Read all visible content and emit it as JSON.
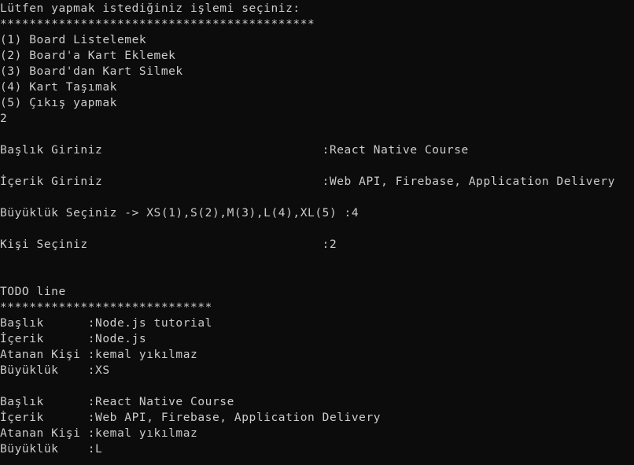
{
  "terminal": {
    "colors": {
      "background": "#0c0c0c",
      "foreground": "#cccccc"
    },
    "lines": [
      "Lütfen yapmak istediğiniz işlemi seçiniz:",
      "*******************************************",
      "(1) Board Listelemek",
      "(2) Board'a Kart Eklemek",
      "(3) Board'dan Kart Silmek",
      "(4) Kart Taşımak",
      "(5) Çıkış yapmak",
      "2",
      "",
      "Başlık Giriniz                              :React Native Course",
      "",
      "İçerik Giriniz                              :Web API, Firebase, Application Delivery",
      "",
      "Büyüklük Seçiniz -> XS(1),S(2),M(3),L(4),XL(5) :4",
      "",
      "Kişi Seçiniz                                :2",
      "",
      "",
      "TODO line",
      "*****************************",
      "Başlık      :Node.js tutorial",
      "İçerik      :Node.js",
      "Atanan Kişi :kemal yıkılmaz",
      "Büyüklük    :XS",
      "",
      "Başlık      :React Native Course",
      "İçerik      :Web API, Firebase, Application Delivery",
      "Atanan Kişi :kemal yıkılmaz",
      "Büyüklük    :L"
    ]
  }
}
